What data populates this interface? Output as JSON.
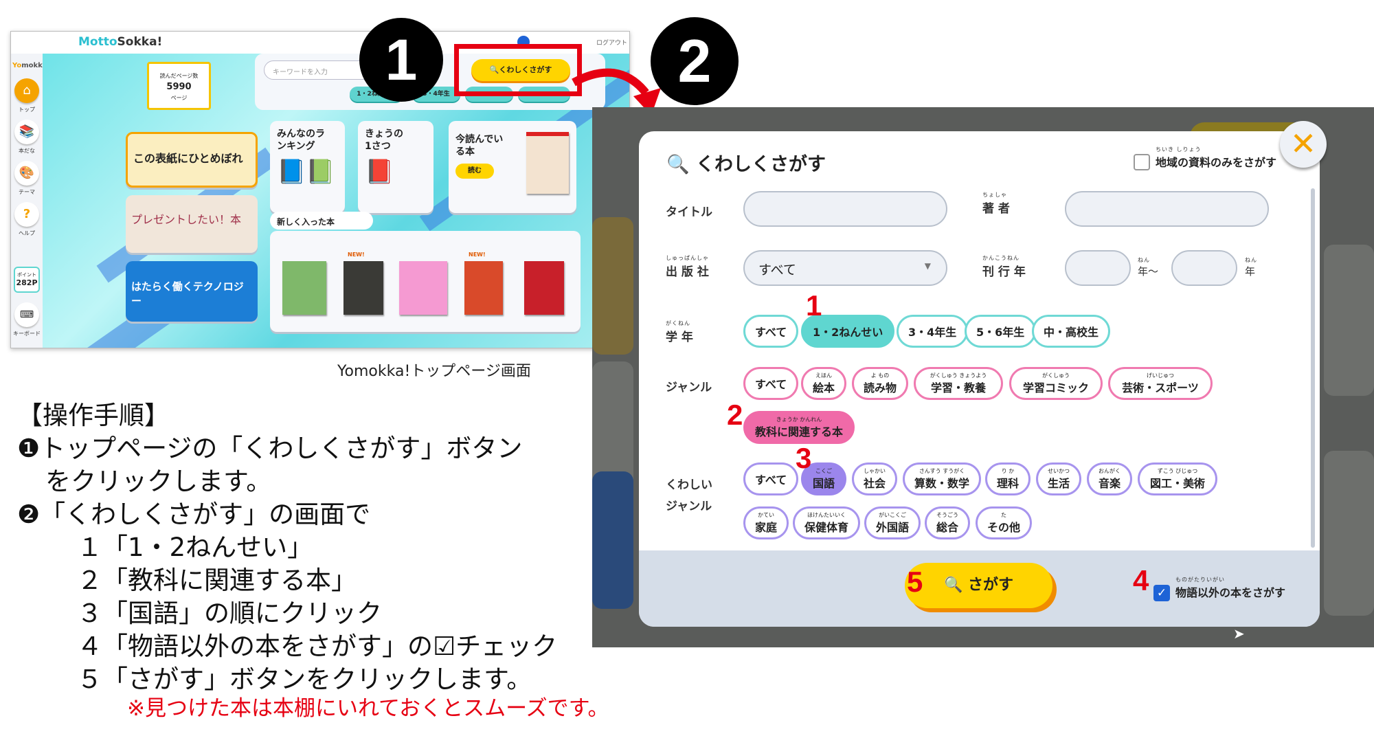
{
  "top_page": {
    "logo_a": "Motto",
    "logo_b": "Sokka!",
    "logout": "ログアウト",
    "sidebar_logo_a": "Yo",
    "sidebar_logo_b": "mokka!",
    "sidebar": [
      {
        "label": "トップ",
        "icon": "house-icon"
      },
      {
        "label": "本だな",
        "icon": "bookshelf-icon"
      },
      {
        "label": "テーマ",
        "icon": "palette-icon"
      },
      {
        "label": "ヘルプ",
        "icon": "question-icon"
      }
    ],
    "points_label": "ポイント",
    "points_value": "282P",
    "keyboard_label": "キーボード",
    "pages_read_label": "読んだページ数",
    "pages_read_value": "5990",
    "pages_unit": "ページ",
    "keyword_placeholder": "キーワードを入力",
    "detail_search_button": "くわしくさがす",
    "grade_pills": [
      "1・2ねんせい",
      "3・4年生",
      "",
      ""
    ],
    "banners": [
      "この表紙にひとめぼれ",
      "プレゼントしたい！本",
      "はたらく働くテクノロジー"
    ],
    "ranking_card": "みんなのランキング",
    "today_card": "きょうの1さつ",
    "reading_card": "今読んでいる本",
    "read_button": "読む",
    "new_books_title": "新しく入った本",
    "new_tag": "NEW!",
    "new_book_colors": [
      "#7fb86a",
      "#3a3a36",
      "#f59ad2",
      "#d94a2a",
      "#c8202a"
    ],
    "accent_yellow": "#ffd400",
    "accent_cyan": "#5fd6d0"
  },
  "caption": "Yomokka!トップページ画面",
  "step_markers": {
    "one": "1",
    "two": "2"
  },
  "modal": {
    "title": "くわしくさがす",
    "local_only": {
      "ruby": "ちいき しりょう",
      "label": "地域の資料のみをさがす",
      "checked": false
    },
    "title_label": "タイトル",
    "title_value": "",
    "author_label": {
      "ruby": "ちょしゃ",
      "label": "著 者"
    },
    "author_value": "",
    "publisher_label": {
      "ruby": "しゅっぱんしゃ",
      "label": "出 版 社"
    },
    "publisher_value": "すべて",
    "year_label": {
      "ruby": "かんこうねん",
      "label": "刊 行 年"
    },
    "year_from_suffix": "年〜",
    "year_to_suffix": "年",
    "year_ruby": "ねん",
    "grade_label": {
      "ruby": "がくねん",
      "label": "学 年"
    },
    "grades": [
      {
        "label": "すべて",
        "ruby": "",
        "selected": false
      },
      {
        "label": "1・2ねんせい",
        "ruby": "",
        "selected": true
      },
      {
        "label": "3・4年生",
        "ruby": "",
        "selected": false
      },
      {
        "label": "5・6年生",
        "ruby": "",
        "selected": false
      },
      {
        "label": "中・高校生",
        "ruby": "",
        "selected": false
      }
    ],
    "genre_label": "ジャンル",
    "genres": [
      {
        "label": "すべて",
        "ruby": "",
        "selected": false
      },
      {
        "label": "絵本",
        "ruby": "えほん",
        "selected": false
      },
      {
        "label": "読み物",
        "ruby": "よ もの",
        "selected": false
      },
      {
        "label": "学習・教養",
        "ruby": "がくしゅう きょうよう",
        "selected": false
      },
      {
        "label": "学習コミック",
        "ruby": "がくしゅう",
        "selected": false
      },
      {
        "label": "芸術・スポーツ",
        "ruby": "げいじゅつ",
        "selected": false
      },
      {
        "label": "教科に関連する本",
        "ruby": "きょうか かんれん",
        "selected": true
      }
    ],
    "detail_genre_label_1": "くわしい",
    "detail_genre_label_2": "ジャンル",
    "subjects": [
      {
        "label": "すべて",
        "ruby": "",
        "selected": false
      },
      {
        "label": "国語",
        "ruby": "こくご",
        "selected": true
      },
      {
        "label": "社会",
        "ruby": "しゃかい",
        "selected": false
      },
      {
        "label": "算数・数学",
        "ruby": "さんすう すうがく",
        "selected": false
      },
      {
        "label": "理科",
        "ruby": "り か",
        "selected": false
      },
      {
        "label": "生活",
        "ruby": "せいかつ",
        "selected": false
      },
      {
        "label": "音楽",
        "ruby": "おんがく",
        "selected": false
      },
      {
        "label": "図工・美術",
        "ruby": "ずこう びじゅつ",
        "selected": false
      },
      {
        "label": "家庭",
        "ruby": "かてい",
        "selected": false
      },
      {
        "label": "保健体育",
        "ruby": "ほけんたいいく",
        "selected": false
      },
      {
        "label": "外国語",
        "ruby": "がいこくご",
        "selected": false
      },
      {
        "label": "総合",
        "ruby": "そうごう",
        "selected": false
      },
      {
        "label": "その他",
        "ruby": "た",
        "selected": false
      }
    ],
    "search_button": "さがす",
    "non_story": {
      "ruby": "ものがたりいがい",
      "label": "物語以外の本をさがす",
      "checked": true
    },
    "annotations": [
      "1",
      "2",
      "3",
      "4",
      "5"
    ]
  },
  "instructions": {
    "heading": "【操作手順】",
    "lines": [
      "❶トップページの「くわしくさがす」ボタン",
      "をクリックします。",
      "❷「くわしくさがす」の画面で",
      "１「1・2ねんせい」",
      "２「教科に関連する本」",
      "３「国語」の順にクリック",
      "４「物語以外の本をさがす」の☑チェック",
      "５「さがす」ボタンをクリックします。"
    ],
    "note": "※見つけた本は本棚にいれておくとスムーズです。",
    "note_color": "#e60012"
  }
}
